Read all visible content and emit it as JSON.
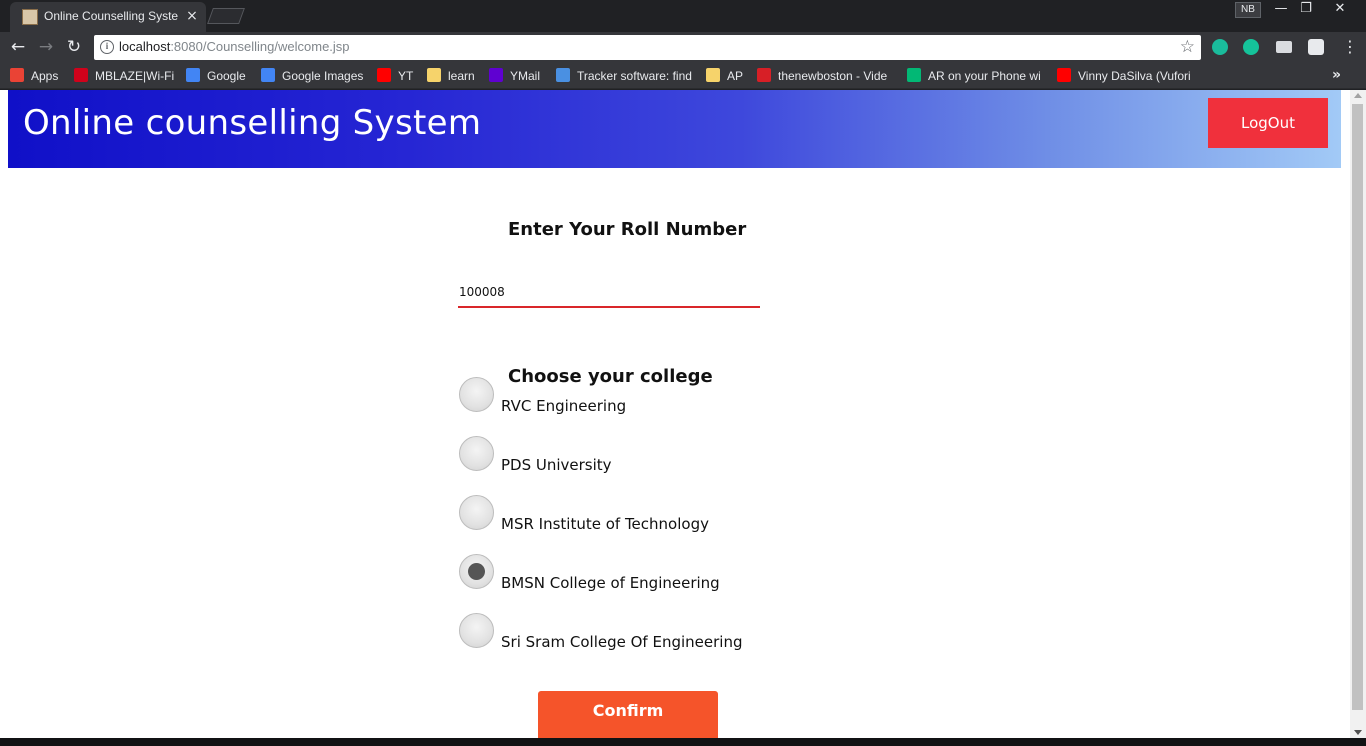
{
  "browser": {
    "tab_title": "Online Counselling System",
    "tab_close": "×",
    "profile_initials": "NB",
    "window_controls": {
      "minimize": "—",
      "restore": "❐",
      "close": "✕"
    },
    "url_host": "localhost",
    "url_rest": ":8080/Counselling/welcome.jsp",
    "nav": {
      "back": "←",
      "forward": "→",
      "reload": "↻",
      "star": "☆",
      "menu": "⋮",
      "info": "i"
    },
    "extension_colors": [
      "#1abc9c",
      "#15c39a",
      "#dadce0",
      "#e8eaed"
    ],
    "bookmarks": [
      {
        "label": "Apps",
        "icon": "apps-grid-icon",
        "color": "#ea4335"
      },
      {
        "label": "MBLAZE|Wi-Fi",
        "icon": "opera-icon",
        "color": "#d0021b"
      },
      {
        "label": "Google",
        "icon": "google-icon",
        "color": "#4285f4"
      },
      {
        "label": "Google Images",
        "icon": "google-icon",
        "color": "#4285f4"
      },
      {
        "label": "YT",
        "icon": "youtube-icon",
        "color": "#ff0000"
      },
      {
        "label": "learn",
        "icon": "folder-icon",
        "color": "#f6d36b"
      },
      {
        "label": "YMail",
        "icon": "yahoo-mail-icon",
        "color": "#5f01d1"
      },
      {
        "label": "Tracker software: find",
        "icon": "tracker-icon",
        "color": "#4a90e2"
      },
      {
        "label": "AP",
        "icon": "folder-icon",
        "color": "#f6d36b"
      },
      {
        "label": "thenewboston - Vide",
        "icon": "thenewboston-icon",
        "color": "#d71f26"
      },
      {
        "label": "AR on your Phone wi",
        "icon": "medium-icon",
        "color": "#02b875"
      },
      {
        "label": "Vinny DaSilva (Vufori",
        "icon": "youtube-icon",
        "color": "#ff0000"
      }
    ],
    "bookmarks_more": "»"
  },
  "page": {
    "site_title": "Online counselling System",
    "logout_label": "LogOut",
    "roll_label": "Enter Your Roll Number",
    "roll_value": "100008",
    "college_label": "Choose your college",
    "colleges": [
      {
        "label": "RVC Engineering",
        "selected": false
      },
      {
        "label": "PDS University",
        "selected": false
      },
      {
        "label": "MSR Institute of Technology",
        "selected": false
      },
      {
        "label": "BMSN College of Engineering",
        "selected": true
      },
      {
        "label": "Sri Sram College Of Engineering",
        "selected": false
      }
    ],
    "confirm_label": "Confirm"
  }
}
